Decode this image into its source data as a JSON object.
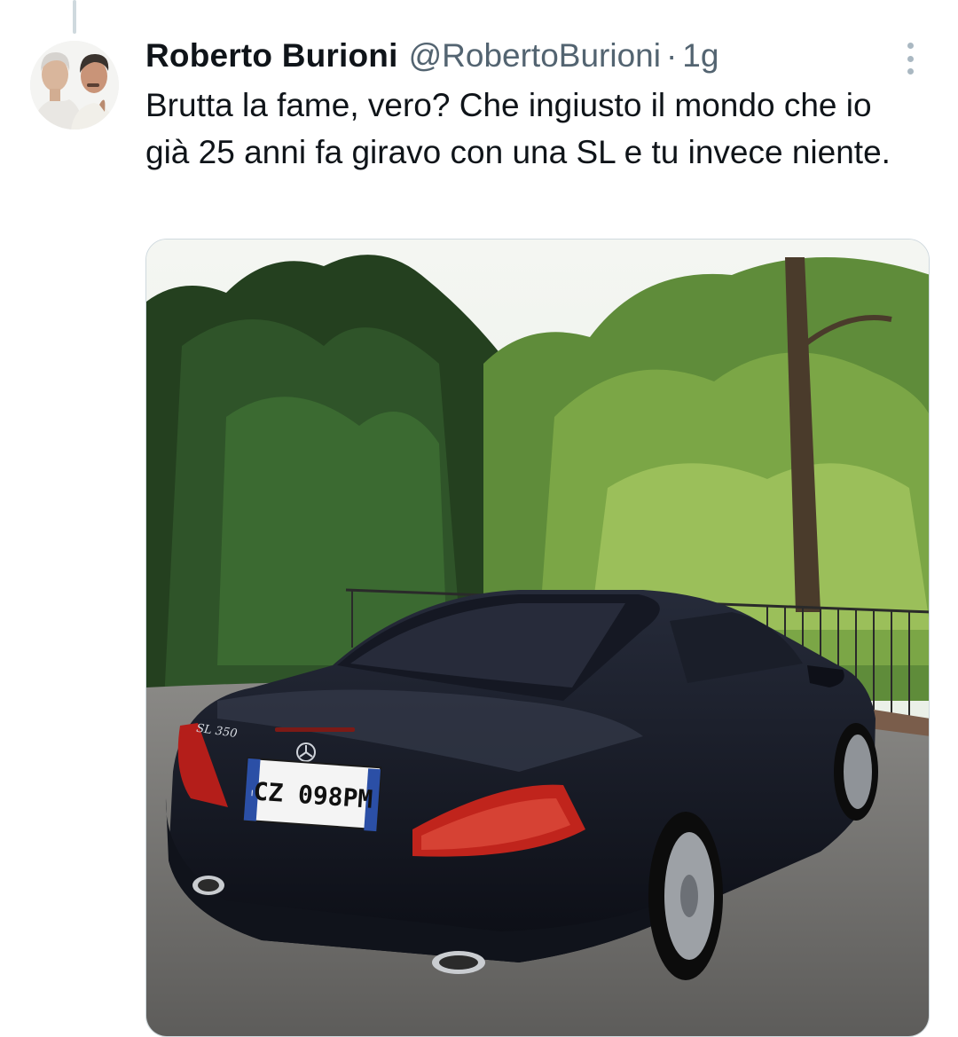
{
  "tweet": {
    "author_name": "Roberto Burioni",
    "author_handle": "@RobertoBurioni",
    "separator": "·",
    "timestamp": "1g",
    "text": "Brutta la fame, vero? Che ingiusto il mondo che io già 25 anni fa giravo con una SL e tu invece niente.",
    "avatar": "avatar-two-men-photo",
    "more_icon": "more-vertical-icon"
  },
  "media": {
    "badge": "SL 350",
    "plate": "CZ 098PM",
    "plate_country": "I"
  },
  "colors": {
    "text_primary": "#0f1419",
    "text_secondary": "#536471",
    "border": "#cfd9de"
  }
}
